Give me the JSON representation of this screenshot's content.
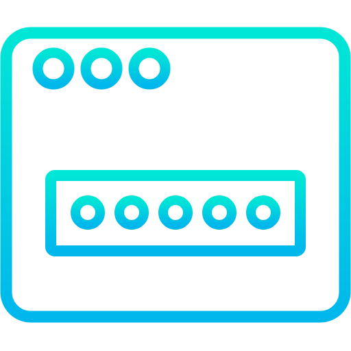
{
  "icon": {
    "name": "password-browser-window-icon",
    "gradient": {
      "top_color": "#00E6D6",
      "bottom_color": "#00B7EC"
    },
    "window": {
      "control_count": 3
    },
    "password_field": {
      "masked_character_count": 5
    }
  }
}
